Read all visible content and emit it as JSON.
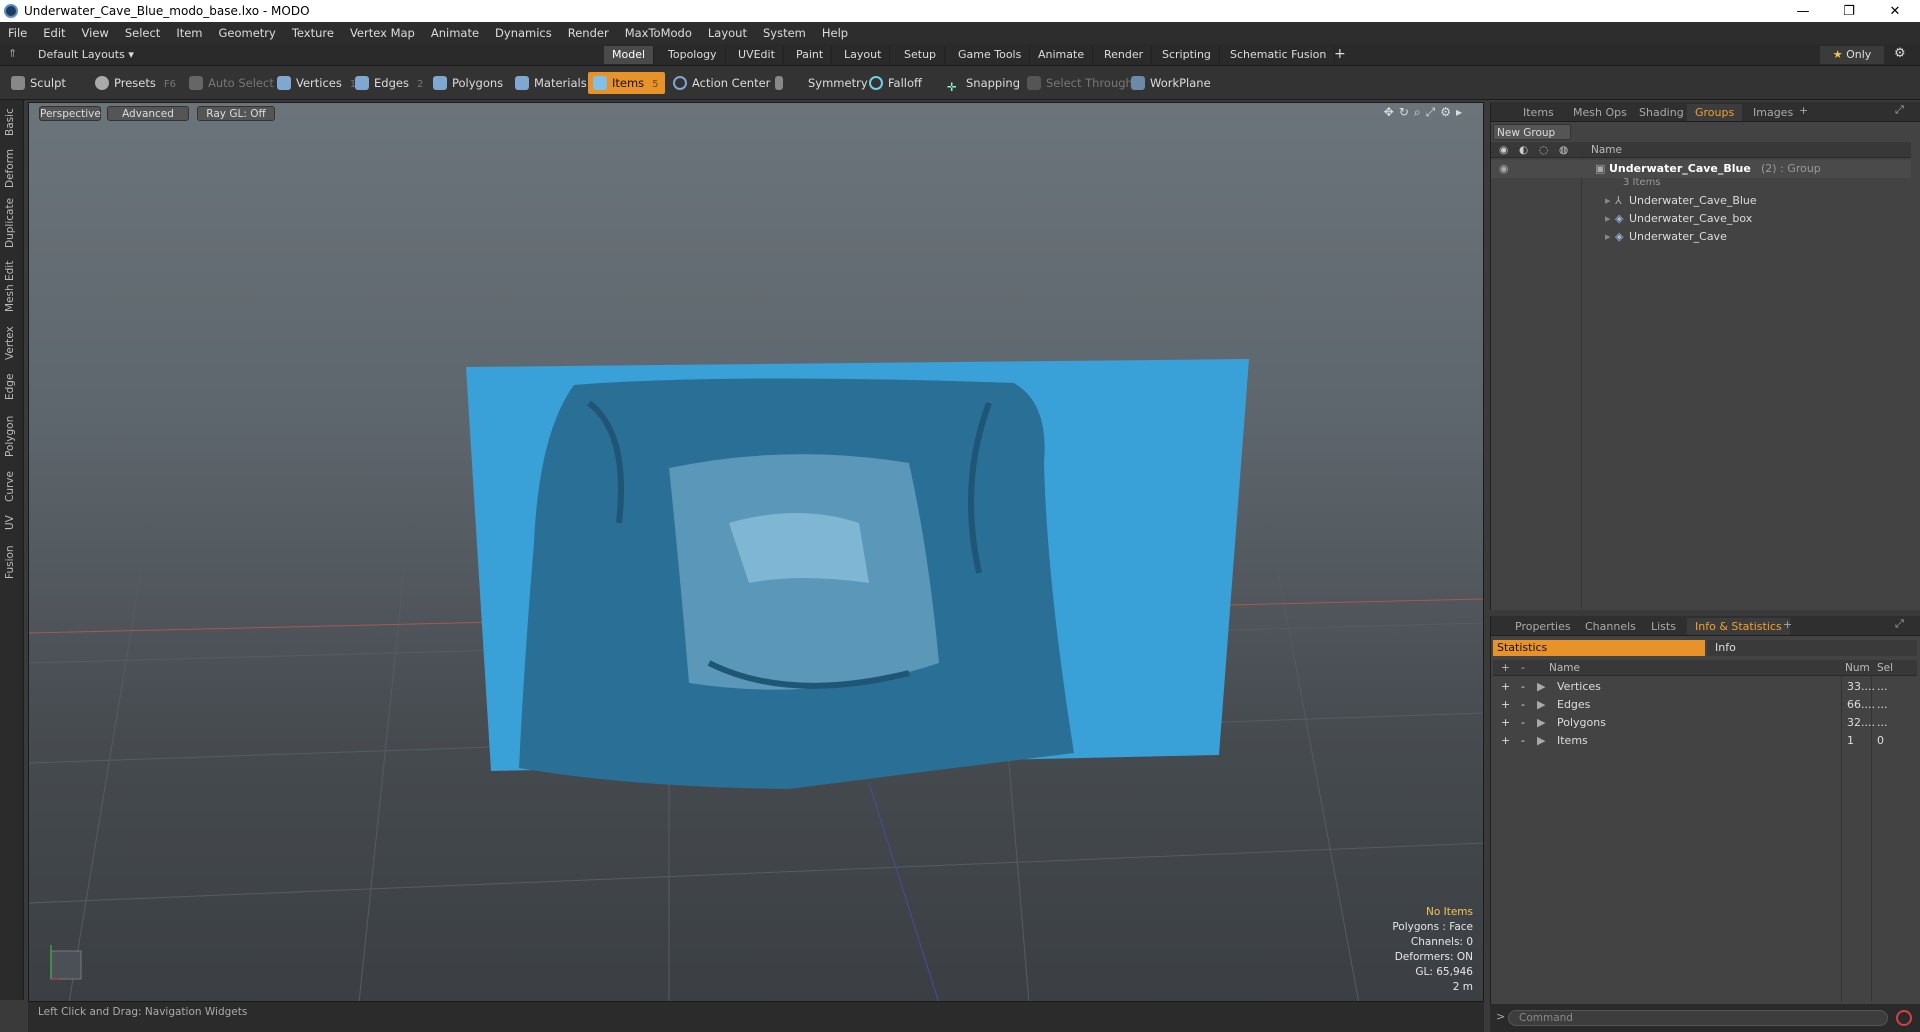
{
  "window": {
    "title": "Underwater_Cave_Blue_modo_base.lxo - MODO",
    "minimize": "—",
    "maximize": "❐",
    "close": "✕"
  },
  "menu": [
    "File",
    "Edit",
    "View",
    "Select",
    "Item",
    "Geometry",
    "Texture",
    "Vertex Map",
    "Animate",
    "Dynamics",
    "Render",
    "MaxToModo",
    "Layout",
    "System",
    "Help"
  ],
  "layoutbar": {
    "layout_name": "Default Layouts",
    "tabs": [
      "Model",
      "Topology",
      "UVEdit",
      "Paint",
      "Layout",
      "Setup",
      "Game Tools",
      "Animate",
      "Render",
      "Scripting",
      "Schematic Fusion"
    ],
    "add": "+",
    "only": "Only"
  },
  "toolbar": {
    "sculpt": "Sculpt",
    "presets": "Presets",
    "presets_key": "F6",
    "auto_select": "Auto Select",
    "vertices": "Vertices",
    "vertices_num": "1",
    "edges": "Edges",
    "edges_num": "2",
    "polygons": "Polygons",
    "materials": "Materials",
    "items": "Items",
    "items_num": "5",
    "action_center": "Action Center",
    "symmetry": "Symmetry",
    "falloff": "Falloff",
    "snapping": "Snapping",
    "select_through": "Select Through",
    "workplane": "WorkPlane"
  },
  "left_tabs": [
    "Basic",
    "Deform",
    "Duplicate",
    "Mesh Edit",
    "Vertex",
    "Edge",
    "Polygon",
    "Curve",
    "UV",
    "Fusion"
  ],
  "viewport": {
    "perspective": "Perspective",
    "advanced": "Advanced",
    "raygl": "Ray GL: Off",
    "overlay": {
      "no_items": "No Items",
      "polygons": "Polygons : Face",
      "channels": "Channels: 0",
      "deformers": "Deformers: ON",
      "gl": "GL: 65,946",
      "scale": "2 m"
    }
  },
  "status": "Left Click and Drag:   Navigation Widgets",
  "groups_panel": {
    "tabs": [
      "Items",
      "Mesh Ops",
      "Shading",
      "Groups",
      "Images"
    ],
    "active_tab": "Groups",
    "new_group": "New Group",
    "name_header": "Name",
    "group": {
      "name": "Underwater_Cave_Blue",
      "count": "(2)",
      "type": ": Group",
      "sub": "3 Items"
    },
    "children": [
      "Underwater_Cave_Blue",
      "Underwater_Cave_box",
      "Underwater_Cave"
    ]
  },
  "info_panel": {
    "tabs": [
      "Properties",
      "Channels",
      "Lists",
      "Info & Statistics"
    ],
    "active_tab": "Info & Statistics",
    "subtabs": {
      "statistics": "Statistics",
      "info": "Info"
    },
    "headers": {
      "name": "Name",
      "num": "Num",
      "sel": "Sel"
    },
    "rows": [
      {
        "name": "Vertices",
        "num": "33....",
        "sel": "..."
      },
      {
        "name": "Edges",
        "num": "66....",
        "sel": "..."
      },
      {
        "name": "Polygons",
        "num": "32....",
        "sel": "..."
      },
      {
        "name": "Items",
        "num": "1",
        "sel": "0"
      }
    ]
  },
  "command": {
    "placeholder": "Command",
    "prompt": ">"
  },
  "colors": {
    "accent": "#e8932a",
    "cave": "#3aa0d8",
    "active_tab_text": "#f0a030"
  }
}
